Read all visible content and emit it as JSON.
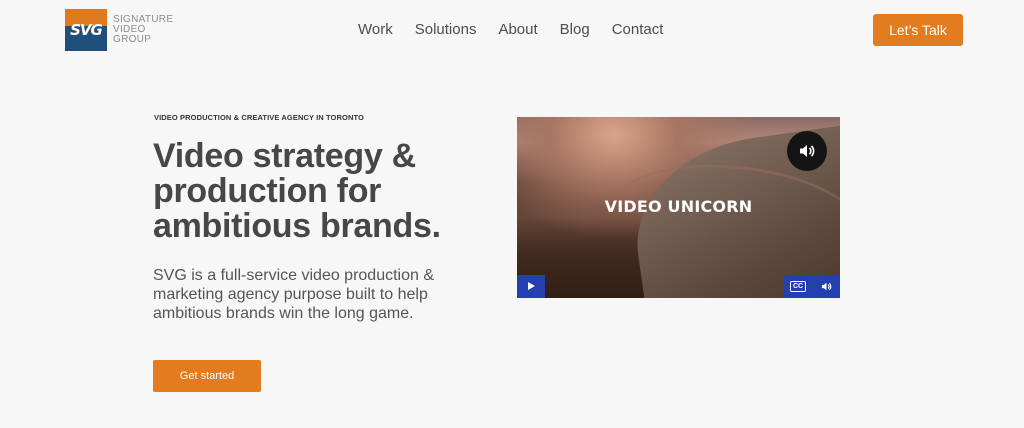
{
  "logo": {
    "mark_text": "SVG",
    "lines": [
      "SIGNATURE",
      "VIDEO",
      "GROUP"
    ],
    "colors": {
      "orange": "#e07a1f",
      "blue": "#1e4e7a"
    }
  },
  "nav": {
    "items": [
      {
        "label": "Work"
      },
      {
        "label": "Solutions"
      },
      {
        "label": "About"
      },
      {
        "label": "Blog"
      },
      {
        "label": "Contact"
      }
    ]
  },
  "header_cta": {
    "label": "Let’s Talk",
    "color": "#e27c1e"
  },
  "hero": {
    "eyebrow": "VIDEO PRODUCTION & CREATIVE AGENCY IN TORONTO",
    "headline_lines": [
      "Video strategy &",
      "production for",
      "ambitious brands."
    ],
    "subtext_lines": [
      "SVG is a full-service video production &",
      "marketing agency purpose built to help",
      "ambitious brands win the long game."
    ],
    "cta_label": "Get started"
  },
  "video": {
    "overlay_title": "VIDEO UNICORN",
    "icons": {
      "unmute": "speaker-icon",
      "play": "play-icon",
      "captions": "closed-captions-icon",
      "volume": "volume-icon"
    },
    "cc_label": "CC",
    "control_color": "#2440b0"
  }
}
